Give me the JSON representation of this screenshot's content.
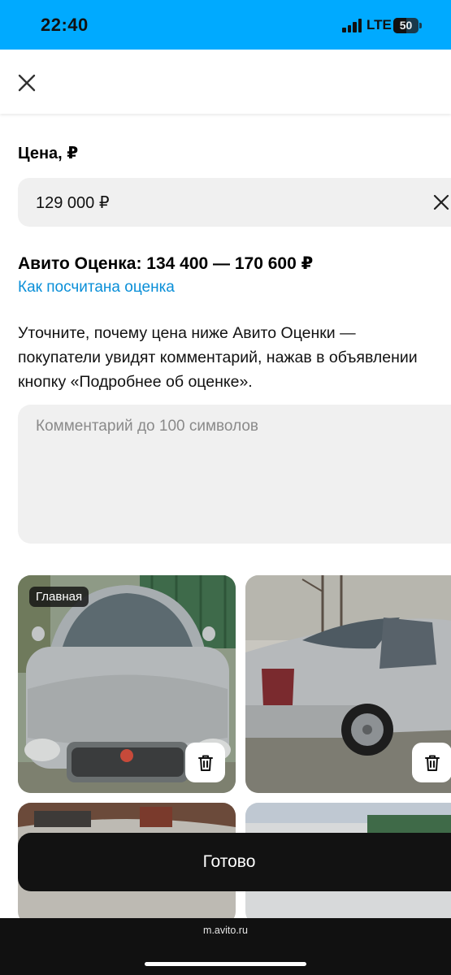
{
  "status_bar": {
    "time": "22:40",
    "network": "LTE",
    "battery": "50",
    "battery_level": 0.5
  },
  "header": {
    "close_icon": "close-icon"
  },
  "price": {
    "label": "Цена, ₽",
    "value": "129 000 ₽",
    "clear_icon": "close-icon"
  },
  "estimate": {
    "title": "Авито Оценка: 134 400 — 170 600 ₽",
    "link": "Как посчитана оценка"
  },
  "hint": {
    "line1": "Уточните, почему цена ниже Авито Оценки —",
    "line2": "покупатели увидят комментарий, нажав в объявлении",
    "line3": "кнопку «Подробнее об оценке»."
  },
  "comment": {
    "value": "",
    "placeholder": "Комментарий до 100 символов"
  },
  "photos": {
    "main_badge": "Главная",
    "delete_icon": "trash-icon"
  },
  "done_button": {
    "label": "Готово"
  },
  "browser": {
    "url": "m.avito.ru"
  },
  "colors": {
    "status_bar": "#00aaff",
    "link": "#0a8fd8",
    "field_bg": "#f0f0f0",
    "done_bg": "#121212"
  }
}
